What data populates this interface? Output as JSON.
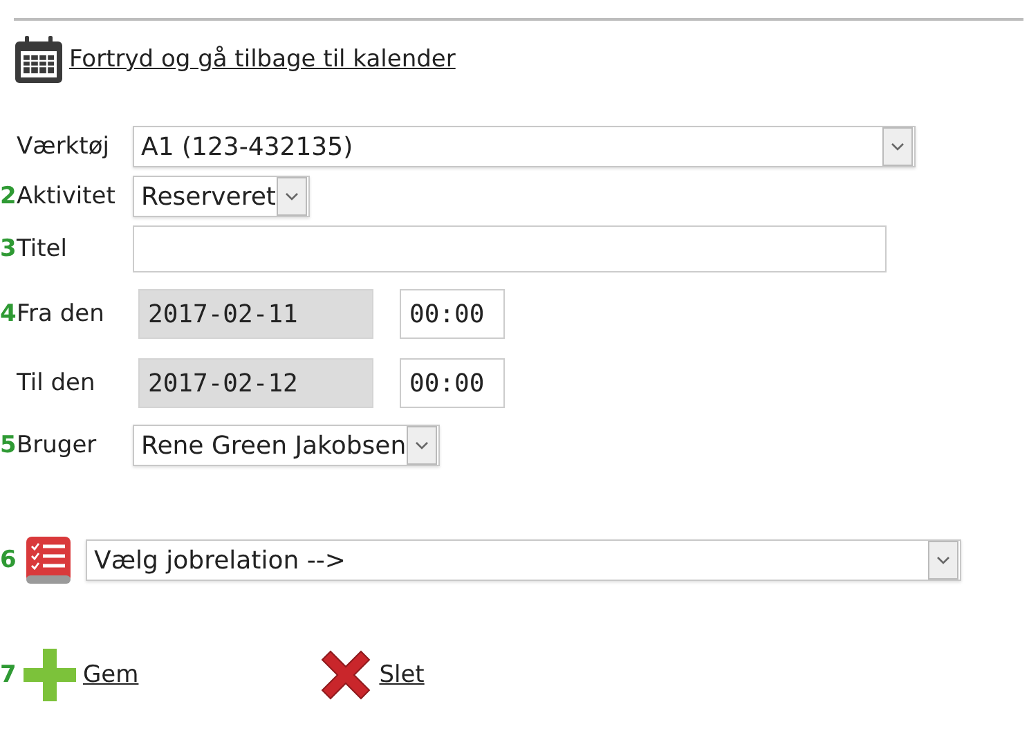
{
  "back_link": "Fortryd og gå tilbage til kalender",
  "fields": [
    {
      "label": "Værktøj",
      "kind": "select",
      "value": "A1 (123-432135)"
    },
    {
      "step": "2",
      "label": "Aktivitet",
      "kind": "select",
      "value": "Reserveret"
    },
    {
      "step": "3",
      "label": "Titel",
      "kind": "text"
    },
    {
      "step": "4",
      "label": "Fra den",
      "kind": "datetime",
      "value": "2017-02-11",
      "time": "00:00",
      "disabled": true
    },
    {
      "label": "Til den",
      "kind": "datetime",
      "value": "2017-02-12",
      "time": "00:00",
      "disabled": true
    },
    {
      "step": "5",
      "label": "Bruger",
      "kind": "select",
      "value": "Rene Green Jakobsen"
    }
  ],
  "job_relation": {
    "step": "6",
    "value": "Vælg jobrelation -->"
  },
  "actions": [
    {
      "step": "7",
      "label": "Gem",
      "kind": "add"
    },
    {
      "label": "Slet",
      "kind": "delete"
    }
  ]
}
